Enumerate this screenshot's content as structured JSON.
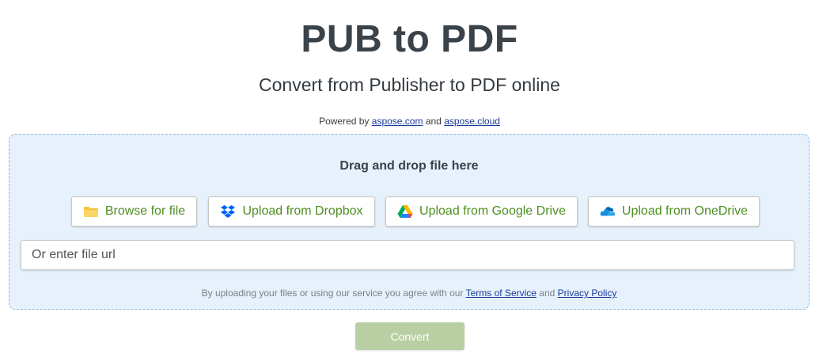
{
  "header": {
    "title": "PUB to PDF",
    "subtitle": "Convert from Publisher to PDF online",
    "powered_prefix": "Powered by",
    "powered_link1": "aspose.com",
    "powered_and": "and",
    "powered_link2": "aspose.cloud"
  },
  "dropzone": {
    "label": "Drag and drop file here",
    "buttons": {
      "browse": "Browse for file",
      "dropbox": "Upload from Dropbox",
      "gdrive": "Upload from Google Drive",
      "onedrive": "Upload from OneDrive"
    },
    "icons": {
      "browse": "folder-icon",
      "dropbox": "dropbox-icon",
      "gdrive": "google-drive-icon",
      "onedrive": "onedrive-icon"
    },
    "url_placeholder": "Or enter file url",
    "url_value": "",
    "terms_prefix": "By uploading your files or using our service you agree with our",
    "terms_link": "Terms of Service",
    "terms_and": "and",
    "privacy_link": "Privacy Policy"
  },
  "actions": {
    "convert_label": "Convert"
  },
  "colors": {
    "accent_green": "#4c8f20",
    "convert_disabled": "#b8cfa3",
    "dropzone_bg": "#e6f1fb",
    "link_blue": "#1a3a9a"
  }
}
